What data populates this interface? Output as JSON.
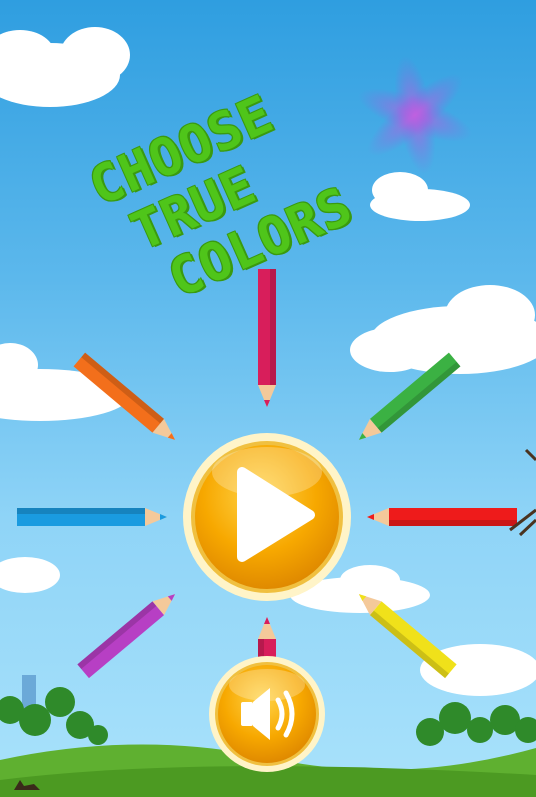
{
  "title": {
    "line1": "CHOOSE",
    "line2": "TRUE",
    "line3": "COLORS",
    "color": "#4fc51a"
  },
  "buttons": {
    "play_icon": "play-icon",
    "sound_icon": "speaker-icon"
  },
  "pencil_colors": [
    "#d81e5b",
    "#3bb143",
    "#ee1b1b",
    "#f0e11a",
    "#b73fc4",
    "#1a9be0",
    "#f36f1b",
    "#d81e5b"
  ],
  "palette": {
    "sky": "#4fb0ea",
    "grass": "#5fb030",
    "button_gold": "#f7a500"
  }
}
